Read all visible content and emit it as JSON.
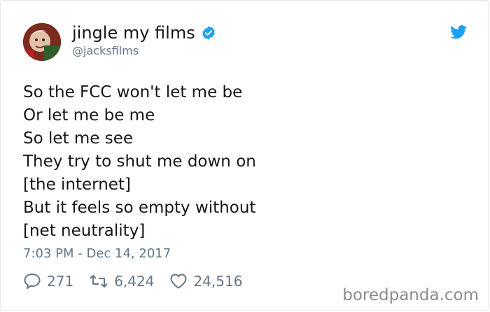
{
  "author": {
    "display_name": "jingle my films",
    "handle": "@jacksfilms",
    "avatar_icon": "user-avatar",
    "verified_icon": "verified-badge-icon"
  },
  "tweet": {
    "lines": [
      "So the FCC won't let me be",
      "Or let me be me",
      "So let me see",
      "They try to shut me down on",
      "[the internet]",
      "But it feels so empty without",
      "[net neutrality]"
    ],
    "timestamp": "7:03 PM - Dec 14, 2017"
  },
  "actions": {
    "replies": "271",
    "retweets": "6,424",
    "likes": "24,516"
  },
  "watermark": "boredpanda.com",
  "colors": {
    "twitter_blue": "#1da1f2",
    "text": "#14171a",
    "muted": "#657786"
  }
}
